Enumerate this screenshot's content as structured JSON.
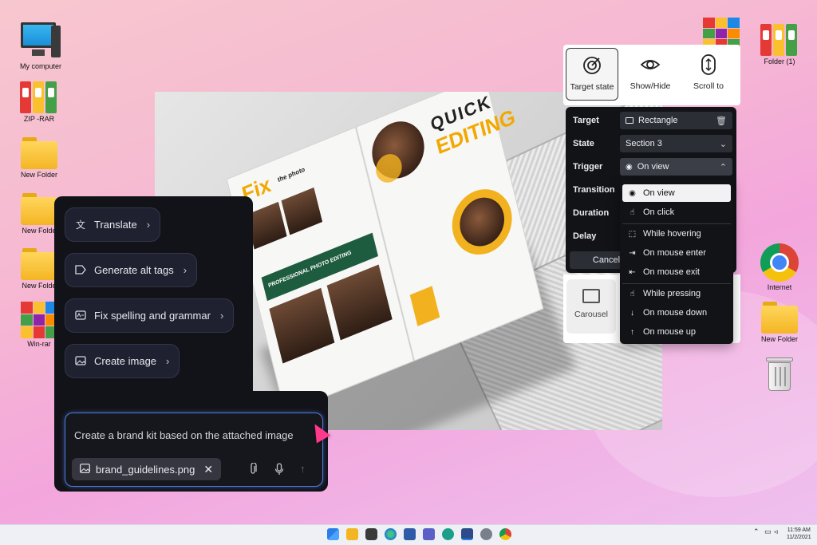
{
  "desktop": {
    "icons": [
      {
        "label": "My computer"
      },
      {
        "label": "ZIP -RAR"
      },
      {
        "label": "New Folder"
      },
      {
        "label": "New Folde"
      },
      {
        "label": "New Folde"
      },
      {
        "label": "Win-rar"
      },
      {
        "label": "Folder (1)"
      },
      {
        "label": "Internet"
      },
      {
        "label": "New Folder"
      }
    ]
  },
  "brochure": {
    "headline_1": "QUICK",
    "headline_2": "EDITING",
    "brand_main": "Fix",
    "brand_sub": "the photo",
    "section_title": "PROFESSIONAL PHOTO EDITING"
  },
  "ai_panel": {
    "actions": [
      {
        "label": "Translate",
        "icon": "translate-icon"
      },
      {
        "label": "Generate alt tags",
        "icon": "tag-icon"
      },
      {
        "label": "Fix spelling and grammar",
        "icon": "spellcheck-icon"
      },
      {
        "label": "Create image",
        "icon": "image-icon"
      }
    ],
    "prompt_text": "Create a brand kit based on the attached image",
    "attachment_name": "brand_guidelines.png"
  },
  "interaction_editor": {
    "toolbar": [
      {
        "label": "Target state",
        "icon": "target-icon",
        "selected": true
      },
      {
        "label": "Show/Hide",
        "icon": "eye-icon",
        "selected": false
      },
      {
        "label": "Scroll to",
        "icon": "scroll-icon",
        "selected": false
      }
    ],
    "fields": {
      "target_label": "Target",
      "target_value": "Rectangle",
      "state_label": "State",
      "state_value": "Section 3",
      "trigger_label": "Trigger",
      "trigger_value": "On view",
      "transition_label": "Transition",
      "duration_label": "Duration",
      "delay_label": "Delay"
    },
    "cancel_label": "Cancel",
    "carousel_label": "Carousel",
    "trigger_options": [
      {
        "label": "On view",
        "icon": "eye-icon",
        "selected": true
      },
      {
        "label": "On click",
        "icon": "pointer-icon",
        "selected": false
      },
      {
        "label": "While hovering",
        "icon": "hover-icon",
        "selected": false
      },
      {
        "label": "On mouse enter",
        "icon": "enter-icon",
        "selected": false
      },
      {
        "label": "On mouse exit",
        "icon": "exit-icon",
        "selected": false
      },
      {
        "label": "While pressing",
        "icon": "press-icon",
        "selected": false
      },
      {
        "label": "On mouse down",
        "icon": "arrow-down-icon",
        "selected": false
      },
      {
        "label": "On mouse up",
        "icon": "arrow-up-icon",
        "selected": false
      }
    ]
  },
  "taskbar": {
    "time": "11:59 AM",
    "date": "11/2/2021"
  },
  "colors": {
    "accent_blue": "#4a7dd6",
    "cursor_pink": "#ff3a8a",
    "panel_dark": "#121317",
    "brochure_yellow": "#f2b21f"
  }
}
